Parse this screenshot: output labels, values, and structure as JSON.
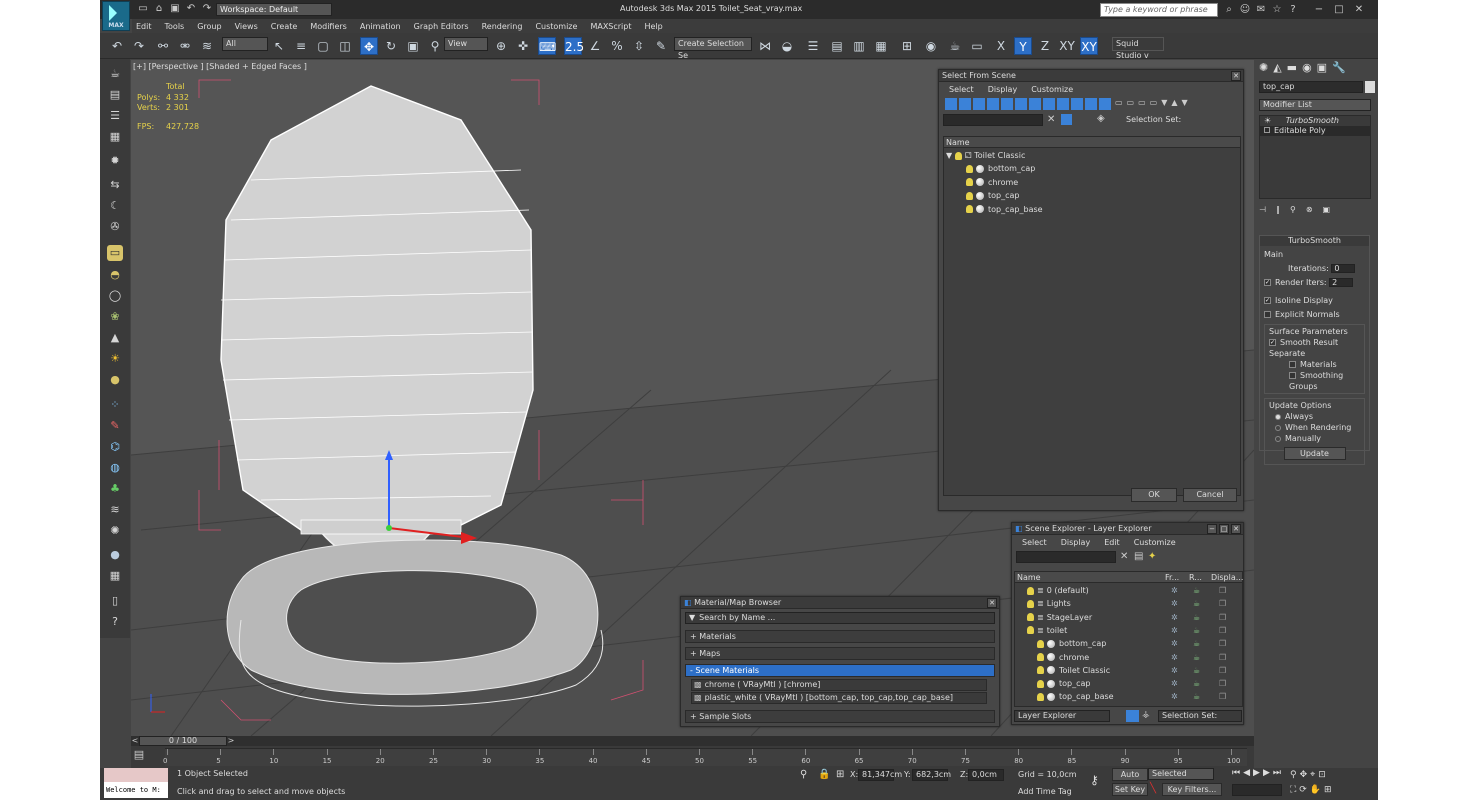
{
  "titlebar": {
    "logo_text": "MAX",
    "workspace": "Workspace: Default",
    "title": "Autodesk 3ds Max  2015    Toilet_Seat_vray.max",
    "search_placeholder": "Type a keyword or phrase"
  },
  "menu": [
    "Edit",
    "Tools",
    "Group",
    "Views",
    "Create",
    "Modifiers",
    "Animation",
    "Graph Editors",
    "Rendering",
    "Customize",
    "MAXScript",
    "Help"
  ],
  "toolbar": {
    "selection_filter": "All",
    "ref_coord": "View",
    "selection_set_placeholder": "Create Selection Se",
    "squid_studio": "Squid Studio v"
  },
  "viewport": {
    "label": "[+] [Perspective ] [Shaded + Edged Faces ]",
    "stats": {
      "header": "Total",
      "polys_label": "Polys:",
      "polys": "4 332",
      "verts_label": "Verts:",
      "verts": "2 301",
      "fps_label": "FPS:",
      "fps": "427,728"
    }
  },
  "select_from_scene": {
    "title": "Select From Scene",
    "menu": [
      "Select",
      "Display",
      "Customize"
    ],
    "selection_set_label": "Selection Set:",
    "column_name": "Name",
    "root": "Toilet Classic",
    "items": [
      "bottom_cap",
      "chrome",
      "top_cap",
      "top_cap_base"
    ],
    "ok": "OK",
    "cancel": "Cancel"
  },
  "material_browser": {
    "title": "Material/Map Browser",
    "search_placeholder": "Search by Name ...",
    "sections": {
      "materials": "+ Materials",
      "maps": "+ Maps",
      "scene_materials": "- Scene Materials",
      "sample_slots": "+ Sample Slots"
    },
    "scene_materials": [
      "chrome  ( VRayMtl ) [chrome]",
      "plastic_white  ( VRayMtl ) [bottom_cap, top_cap,top_cap_base]"
    ]
  },
  "scene_explorer": {
    "title": "Scene Explorer - Layer Explorer",
    "menu": [
      "Select",
      "Display",
      "Edit",
      "Customize"
    ],
    "columns": {
      "name": "Name",
      "frozen": "Fr...",
      "render": "R...",
      "display": "Displa..."
    },
    "rows": [
      {
        "label": "0 (default)",
        "indent": 0
      },
      {
        "label": "Lights",
        "indent": 0
      },
      {
        "label": "StageLayer",
        "indent": 0
      },
      {
        "label": "toilet",
        "indent": 0
      },
      {
        "label": "bottom_cap",
        "indent": 1
      },
      {
        "label": "chrome",
        "indent": 1
      },
      {
        "label": "Toilet Classic",
        "indent": 1
      },
      {
        "label": "top_cap",
        "indent": 1
      },
      {
        "label": "top_cap_base",
        "indent": 1
      }
    ],
    "footer_dropdown": "Layer Explorer",
    "footer_selection_set": "Selection Set:"
  },
  "command_panel": {
    "object_name": "top_cap",
    "modifier_list": "Modifier List",
    "stack": [
      "TurboSmooth",
      "Editable Poly"
    ],
    "turbosmooth": {
      "title": "TurboSmooth",
      "main": "Main",
      "iterations_label": "Iterations:",
      "iterations": "0",
      "render_iters_label": "Render Iters:",
      "render_iters": "2",
      "isoline": "Isoline Display",
      "explicit_normals": "Explicit Normals",
      "surface_params": "Surface Parameters",
      "smooth_result": "Smooth Result",
      "separate": "Separate",
      "materials": "Materials",
      "smoothing_groups": "Smoothing Groups",
      "update_options": "Update Options",
      "always": "Always",
      "when_rendering": "When Rendering",
      "manually": "Manually",
      "update": "Update"
    }
  },
  "timeline": {
    "slider": "0 / 100",
    "ticks": [
      "0",
      "5",
      "10",
      "15",
      "20",
      "25",
      "30",
      "35",
      "40",
      "45",
      "50",
      "55",
      "60",
      "65",
      "70",
      "75",
      "80",
      "85",
      "90",
      "95",
      "100"
    ]
  },
  "status": {
    "maxscript": "Welcome to M:",
    "selected": "1 Object Selected",
    "prompt": "Click and drag to select and move objects",
    "x_label": "X:",
    "x": "81,347cm",
    "y_label": "Y:",
    "y": "682,3cm",
    "z_label": "Z:",
    "z": "0,0cm",
    "grid": "Grid = 10,0cm",
    "add_time_tag": "Add Time Tag",
    "auto_key": "Auto Key",
    "set_key": "Set Key",
    "key_mode": "Selected",
    "key_filters": "Key Filters..."
  }
}
